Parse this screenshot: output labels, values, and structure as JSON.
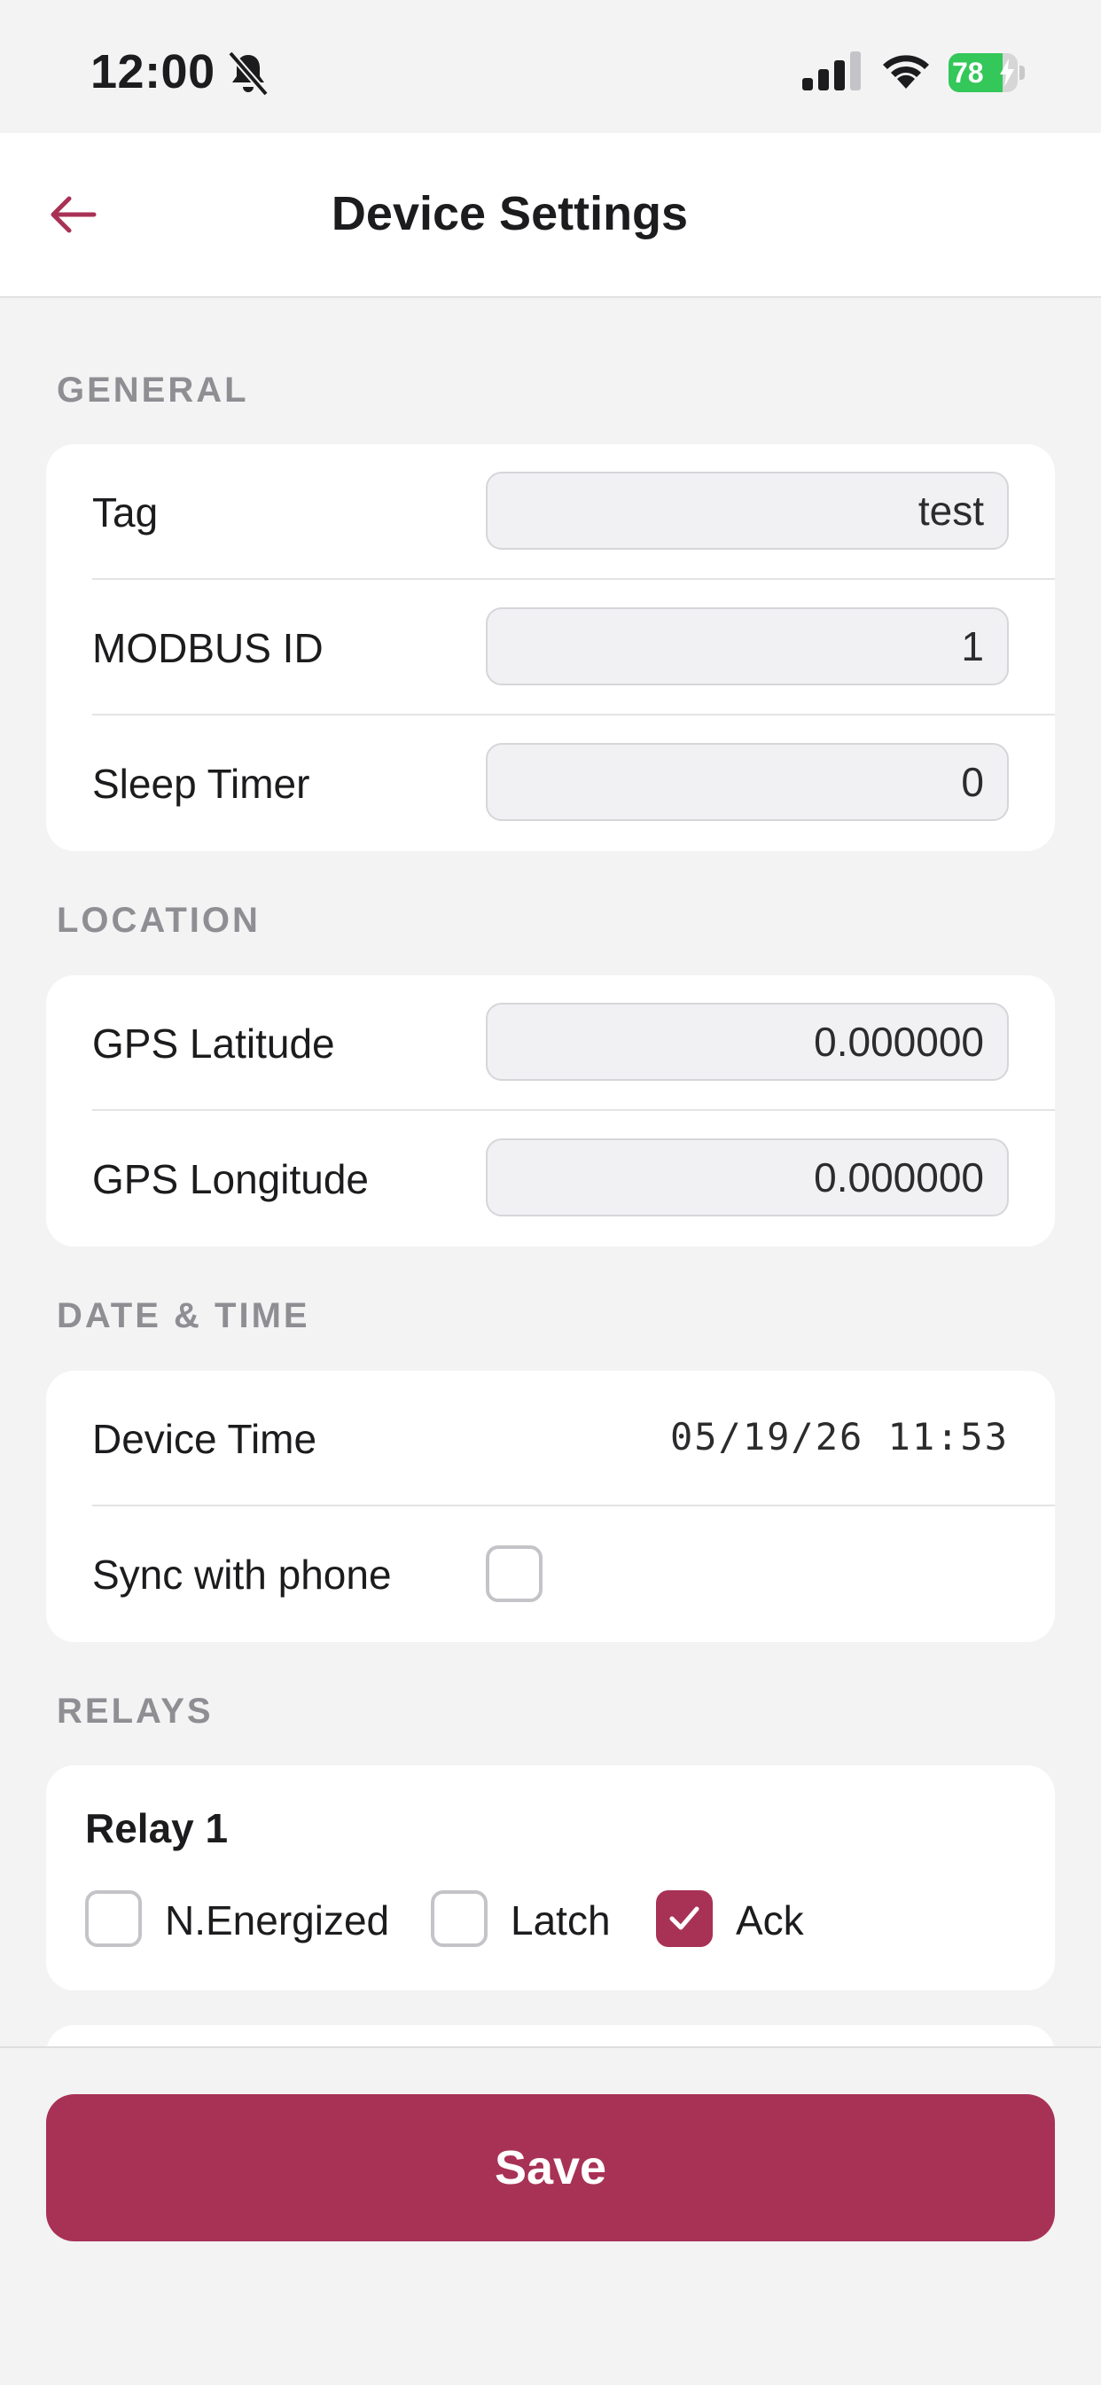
{
  "status_bar": {
    "time": "12:00",
    "battery_percent": 78,
    "battery_text": "78",
    "icons": [
      "bell-slash-icon",
      "cellular-signal-icon",
      "wifi-icon",
      "battery-charging-icon"
    ]
  },
  "header": {
    "title": "Device Settings",
    "back_icon": "arrow-left-icon"
  },
  "sections": {
    "general": {
      "label": "GENERAL",
      "tag": {
        "label": "Tag",
        "value": "test"
      },
      "modbus_id": {
        "label": "MODBUS ID",
        "value": "1"
      },
      "sleep_timer": {
        "label": "Sleep Timer",
        "value": "0"
      }
    },
    "location": {
      "label": "LOCATION",
      "latitude": {
        "label": "GPS Latitude",
        "value": "0.000000"
      },
      "longitude": {
        "label": "GPS Longitude",
        "value": "0.000000"
      }
    },
    "datetime": {
      "label": "DATE & TIME",
      "device_time": {
        "label": "Device Time",
        "value": "05/19/26 11:53"
      },
      "sync": {
        "label": "Sync with phone",
        "checked": false
      }
    },
    "relays": {
      "label": "RELAYS",
      "relay1": {
        "title": "Relay 1",
        "options": [
          {
            "label": "N.Energized",
            "checked": false
          },
          {
            "label": "Latch",
            "checked": false
          },
          {
            "label": "Ack",
            "checked": true
          }
        ]
      }
    }
  },
  "footer": {
    "save_label": "Save"
  },
  "colors": {
    "accent": "#a83255",
    "background": "#f3f3f4",
    "card": "#ffffff",
    "battery_green": "#34c759",
    "section_label": "#8e8e93"
  }
}
